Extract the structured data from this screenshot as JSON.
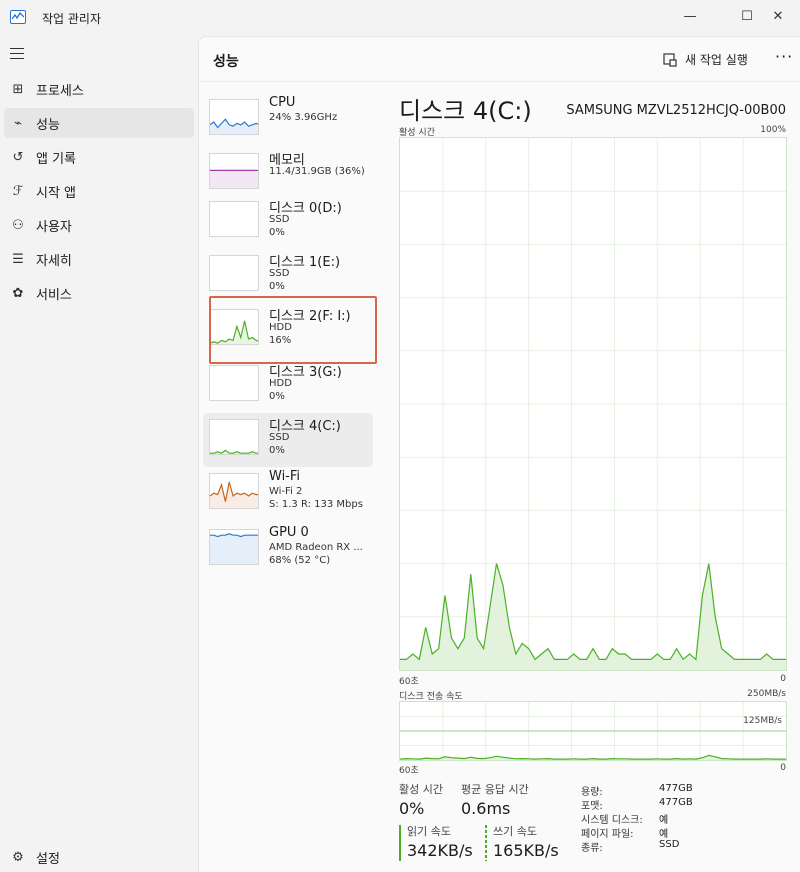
{
  "window": {
    "title": "작업 관리자",
    "controls": {
      "minimize": "—",
      "maximize": "☐",
      "close": "✕"
    }
  },
  "sidebar": {
    "items": [
      {
        "label": "프로세스",
        "icon": "processes-icon",
        "glyph": "⊞"
      },
      {
        "label": "성능",
        "icon": "performance-icon",
        "glyph": "⌁"
      },
      {
        "label": "앱 기록",
        "icon": "history-icon",
        "glyph": "↺"
      },
      {
        "label": "시작 앱",
        "icon": "startup-icon",
        "glyph": "ℱ"
      },
      {
        "label": "사용자",
        "icon": "users-icon",
        "glyph": "⚇"
      },
      {
        "label": "자세히",
        "icon": "details-icon",
        "glyph": "☰"
      },
      {
        "label": "서비스",
        "icon": "services-icon",
        "glyph": "✿"
      }
    ],
    "settings_label": "설정"
  },
  "header": {
    "title": "성능",
    "run_task_label": "새 작업 실행",
    "more": "···"
  },
  "resources": [
    {
      "name": "CPU",
      "l2": "24% 3.96GHz",
      "l3": "",
      "color": "#2a7bd0"
    },
    {
      "name": "메모리",
      "l2": "11.4/31.9GB (36%)",
      "l3": "",
      "color": "#a23ca8"
    },
    {
      "name": "디스크 0(D:)",
      "l2": "SSD",
      "l3": "0%",
      "color": "#4caf28"
    },
    {
      "name": "디스크 1(E:)",
      "l2": "SSD",
      "l3": "0%",
      "color": "#4caf28"
    },
    {
      "name": "디스크 2(F: I:)",
      "l2": "HDD",
      "l3": "16%",
      "color": "#4caf28"
    },
    {
      "name": "디스크 3(G:)",
      "l2": "HDD",
      "l3": "0%",
      "color": "#4caf28"
    },
    {
      "name": "디스크 4(C:)",
      "l2": "SSD",
      "l3": "0%",
      "color": "#4caf28"
    },
    {
      "name": "Wi-Fi",
      "l2": "Wi-Fi 2",
      "l3": "S: 1.3  R: 133 Mbps",
      "color": "#c2661e"
    },
    {
      "name": "GPU 0",
      "l2": "AMD Radeon RX ...",
      "l3": "68% (52 °C)",
      "color": "#2a7bd0"
    }
  ],
  "detail": {
    "title": "디스크 4(C:)",
    "model": "SAMSUNG MZVL2512HCJQ-00B00",
    "active_time_label": "활성 시간",
    "active_time_max": "100%",
    "time_start": "60초",
    "time_end": "0",
    "transfer_label": "디스크 전송 속도",
    "transfer_max": "250MB/s",
    "transfer_mid": "125MB/s",
    "time_start2": "60초",
    "time_end2": "0"
  },
  "stats": {
    "active_time_label": "활성 시간",
    "active_time_value": "0%",
    "response_label": "평균 응답 시간",
    "response_value": "0.6ms",
    "read_label": "읽기 속도",
    "read_value": "342KB/s",
    "write_label": "쓰기 속도",
    "write_value": "165KB/s"
  },
  "info": [
    {
      "k": "용량:",
      "v": "477GB"
    },
    {
      "k": "포맷:",
      "v": "477GB"
    },
    {
      "k": "시스템 디스크:",
      "v": "예"
    },
    {
      "k": "페이지 파일:",
      "v": "예"
    },
    {
      "k": "종류:",
      "v": "SSD"
    }
  ],
  "chart_data": [
    {
      "type": "area",
      "title": "활성 시간",
      "ylabel": "",
      "ylim": [
        0,
        100
      ],
      "x_range_label": [
        "60초",
        "0"
      ],
      "values": [
        2,
        2,
        3,
        2,
        8,
        3,
        4,
        14,
        6,
        4,
        6,
        18,
        6,
        4,
        12,
        20,
        16,
        8,
        3,
        5,
        4,
        2,
        3,
        4,
        2,
        2,
        2,
        3,
        2,
        2,
        4,
        2,
        2,
        4,
        3,
        3,
        2,
        2,
        2,
        2,
        3,
        2,
        2,
        4,
        2,
        3,
        2,
        14,
        20,
        10,
        4,
        3,
        2,
        2,
        2,
        2,
        2,
        3,
        2,
        2,
        2
      ]
    },
    {
      "type": "area",
      "title": "디스크 전송 속도",
      "ylabel": "",
      "ylim": [
        0,
        250
      ],
      "x_range_label": [
        "60초",
        "0"
      ],
      "values": [
        4,
        6,
        5,
        4,
        8,
        6,
        5,
        14,
        10,
        8,
        6,
        12,
        7,
        6,
        10,
        16,
        12,
        8,
        5,
        6,
        5,
        4,
        5,
        6,
        4,
        4,
        4,
        5,
        4,
        4,
        6,
        4,
        4,
        6,
        5,
        5,
        4,
        4,
        4,
        4,
        5,
        4,
        4,
        6,
        4,
        5,
        4,
        10,
        20,
        14,
        6,
        5,
        4,
        4,
        4,
        4,
        4,
        5,
        4,
        4,
        4
      ]
    }
  ]
}
